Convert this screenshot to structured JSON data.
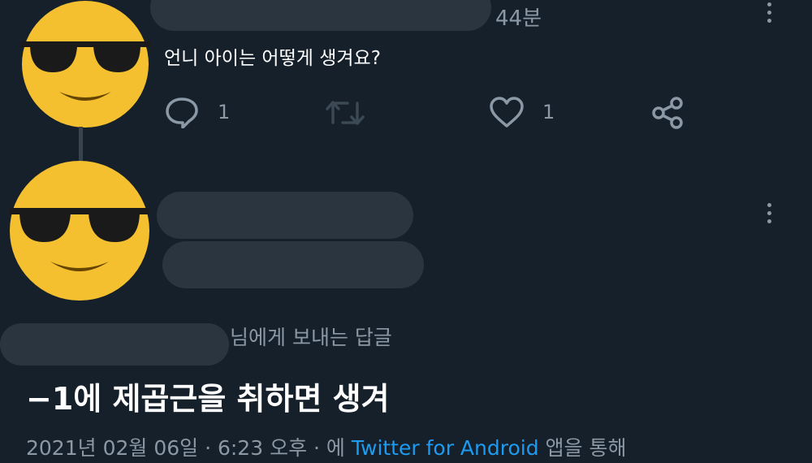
{
  "reply_tweet": {
    "avatar": "sunglasses-face-emoji",
    "time": "44분",
    "text": "언니 아이는 어떻게 생겨요?",
    "reply_count": "1",
    "like_count": "1",
    "icons": [
      "reply-icon",
      "retweet-icon",
      "like-icon",
      "share-icon",
      "more-icon"
    ]
  },
  "main_tweet": {
    "avatar": "sunglasses-face-emoji",
    "reply_to_suffix": "님에게 보내는 답글",
    "text": "−1에 제곱근을 취하면 생겨",
    "meta_date": "2021년 02월 06일 · 6:23 오후 · 에 ",
    "meta_source": "Twitter for Android",
    "meta_suffix": " 앱을 통해"
  },
  "colors": {
    "background": "#15202b",
    "muted": "#8b98a5",
    "link": "#1d9bf0",
    "redaction": "#2b3540",
    "emoji_face": "#f4c02f"
  }
}
